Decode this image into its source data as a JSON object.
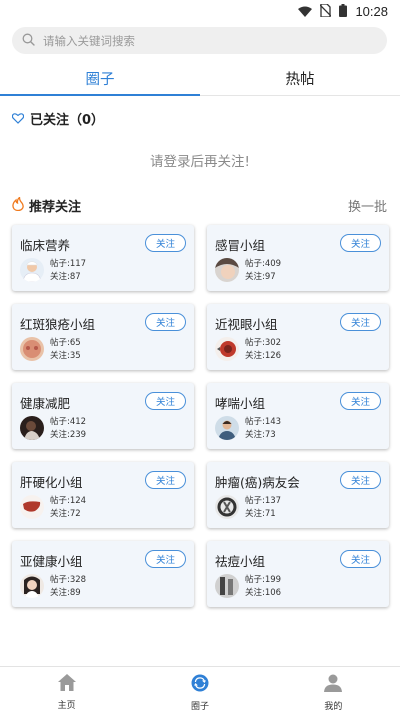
{
  "status_bar": {
    "time": "10:28",
    "icons": [
      "wifi-icon",
      "no-sim-icon",
      "battery-icon"
    ]
  },
  "search": {
    "placeholder": "请输入关键词搜索",
    "icon": "search-icon"
  },
  "tabs": [
    {
      "label": "圈子",
      "active": true
    },
    {
      "label": "热帖",
      "active": false
    }
  ],
  "followed": {
    "title": "已关注（0）",
    "icon": "heart-outline-icon",
    "empty_hint": "请登录后再关注!"
  },
  "recommend": {
    "title": "推荐关注",
    "icon": "flame-icon",
    "refresh_label": "换一批"
  },
  "groups": [
    {
      "name": "临床营养",
      "follow_label": "关注",
      "posts": "帖子:117",
      "followers": "关注:87",
      "avatar": "nurse-avatar"
    },
    {
      "name": "感冒小组",
      "follow_label": "关注",
      "posts": "帖子:409",
      "followers": "关注:97",
      "avatar": "woman-face-avatar"
    },
    {
      "name": "红斑狼疮小组",
      "follow_label": "关注",
      "posts": "帖子:65",
      "followers": "关注:35",
      "avatar": "skin-face-avatar"
    },
    {
      "name": "近视眼小组",
      "follow_label": "关注",
      "posts": "帖子:302",
      "followers": "关注:126",
      "avatar": "eye-diagram-avatar"
    },
    {
      "name": "健康减肥",
      "follow_label": "关注",
      "posts": "帖子:412",
      "followers": "关注:239",
      "avatar": "silhouette-avatar"
    },
    {
      "name": "哮喘小组",
      "follow_label": "关注",
      "posts": "帖子:143",
      "followers": "关注:73",
      "avatar": "person-avatar"
    },
    {
      "name": "肝硬化小组",
      "follow_label": "关注",
      "posts": "帖子:124",
      "followers": "关注:72",
      "avatar": "liver-avatar"
    },
    {
      "name": "肿瘤(癌)病友会",
      "follow_label": "关注",
      "posts": "帖子:137",
      "followers": "关注:71",
      "avatar": "ribbon-avatar"
    },
    {
      "name": "亚健康小组",
      "follow_label": "关注",
      "posts": "帖子:328",
      "followers": "关注:89",
      "avatar": "woman-avatar"
    },
    {
      "name": "祛痘小组",
      "follow_label": "关注",
      "posts": "帖子:199",
      "followers": "关注:106",
      "avatar": "bw-avatar"
    }
  ],
  "bottom_nav": [
    {
      "label": "主页",
      "icon": "home-icon",
      "active": false
    },
    {
      "label": "圈子",
      "icon": "circle-swap-icon",
      "active": true
    },
    {
      "label": "我的",
      "icon": "user-icon",
      "active": false
    }
  ],
  "colors": {
    "accent": "#2f80d6",
    "card_bg": "#f2f6fb",
    "flame": "#f07a1e"
  }
}
